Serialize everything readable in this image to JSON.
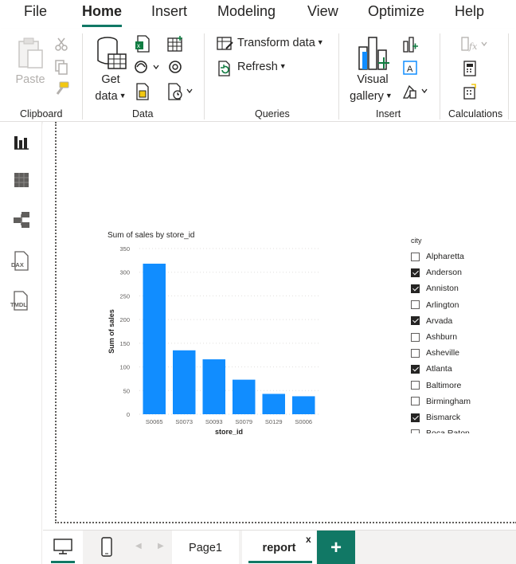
{
  "menu": {
    "tabs": [
      {
        "label": "File"
      },
      {
        "label": "Home"
      },
      {
        "label": "Insert"
      },
      {
        "label": "Modeling"
      },
      {
        "label": "View"
      },
      {
        "label": "Optimize"
      },
      {
        "label": "Help"
      }
    ],
    "active": "Home"
  },
  "ribbon": {
    "clipboard": {
      "paste": "Paste",
      "group": "Clipboard"
    },
    "data": {
      "get": "Get",
      "data": "data",
      "group": "Data"
    },
    "queries": {
      "transform": "Transform data",
      "refresh": "Refresh",
      "group": "Queries"
    },
    "insert": {
      "visual": "Visual",
      "gallery": "gallery",
      "group": "Insert"
    },
    "calculations": {
      "group": "Calculations"
    }
  },
  "leftnav": {
    "items": [
      "report-view-icon",
      "table-view-icon",
      "model-view-icon",
      "dax-query-icon",
      "tmdl-view-icon"
    ],
    "dax_label": "DAX",
    "tmdl_label": "TMDL"
  },
  "chart_data": {
    "type": "bar",
    "title": "Sum of sales by store_id",
    "xlabel": "store_id",
    "ylabel": "Sum of sales",
    "categories": [
      "S0065",
      "S0073",
      "S0093",
      "S0079",
      "S0129",
      "S0006"
    ],
    "values": [
      318,
      135,
      116,
      73,
      43,
      38
    ],
    "ylim": [
      0,
      350
    ],
    "yticks": [
      0,
      50,
      100,
      150,
      200,
      250,
      300,
      350
    ],
    "grid": true,
    "color": "#118DFF"
  },
  "slicer": {
    "title": "city",
    "items": [
      {
        "label": "Alpharetta",
        "checked": false
      },
      {
        "label": "Anderson",
        "checked": true
      },
      {
        "label": "Anniston",
        "checked": true
      },
      {
        "label": "Arlington",
        "checked": false
      },
      {
        "label": "Arvada",
        "checked": true
      },
      {
        "label": "Ashburn",
        "checked": false
      },
      {
        "label": "Asheville",
        "checked": false
      },
      {
        "label": "Atlanta",
        "checked": true
      },
      {
        "label": "Baltimore",
        "checked": false
      },
      {
        "label": "Birmingham",
        "checked": false
      },
      {
        "label": "Bismarck",
        "checked": true
      },
      {
        "label": "Boca Raton",
        "checked": false
      }
    ]
  },
  "pages": {
    "tabs": [
      {
        "label": "Page1"
      },
      {
        "label": "report"
      }
    ],
    "active": "report",
    "close": "x",
    "add": "+"
  },
  "colors": {
    "accent": "#117865",
    "bar": "#118DFF"
  }
}
